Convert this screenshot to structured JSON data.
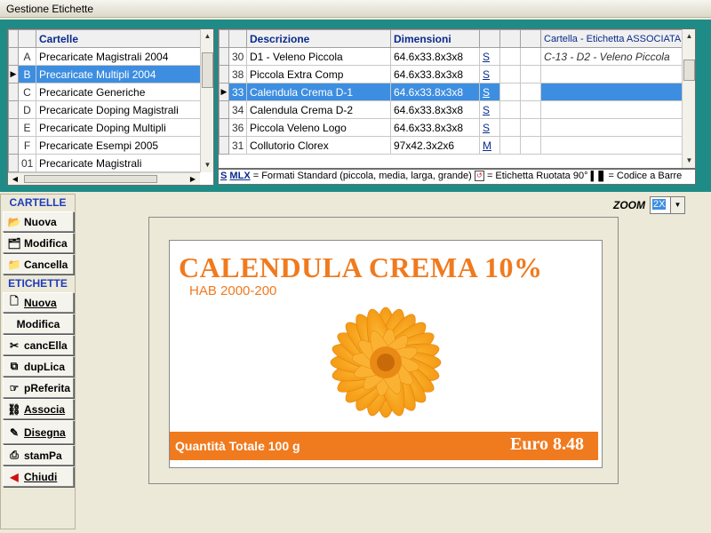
{
  "window": {
    "title": "Gestione Etichette"
  },
  "cartelle_grid": {
    "header": "Cartelle",
    "rows": [
      {
        "key": "A",
        "name": "Precaricate Magistrali 2004"
      },
      {
        "key": "B",
        "name": "Precaricate Multipli 2004"
      },
      {
        "key": "C",
        "name": "Precaricate Generiche"
      },
      {
        "key": "D",
        "name": "Precaricate Doping Magistrali"
      },
      {
        "key": "E",
        "name": "Precaricate Doping Multipli"
      },
      {
        "key": "F",
        "name": "Precaricate Esempi 2005"
      },
      {
        "key": "01",
        "name": "Precaricate Magistrali"
      }
    ]
  },
  "etichette_grid": {
    "headers": {
      "descrizione": "Descrizione",
      "dimensioni": "Dimensioni",
      "associata": "Cartella - Etichetta ASSOCIATA"
    },
    "rows": [
      {
        "num": "30",
        "desc": "D1 - Veleno Piccola",
        "dim": "64.6x33.8x3x8",
        "size": "S",
        "assoc": "C-13 - D2 - Veleno Piccola"
      },
      {
        "num": "38",
        "desc": "Piccola Extra Comp",
        "dim": "64.6x33.8x3x8",
        "size": "S",
        "assoc": ""
      },
      {
        "num": "33",
        "desc": "Calendula Crema D-1",
        "dim": "64.6x33.8x3x8",
        "size": "S",
        "assoc": ""
      },
      {
        "num": "34",
        "desc": "Calendula Crema D-2",
        "dim": "64.6x33.8x3x8",
        "size": "S",
        "assoc": ""
      },
      {
        "num": "36",
        "desc": "Piccola Veleno Logo",
        "dim": "64.6x33.8x3x8",
        "size": "S",
        "assoc": ""
      },
      {
        "num": "31",
        "desc": "Collutorio Clorex",
        "dim": "97x42.3x2x6",
        "size": "M",
        "assoc": ""
      }
    ]
  },
  "legend": {
    "sizes": [
      "S",
      "M",
      "L",
      "X"
    ],
    "formats_text": "= Formati Standard (piccola, media, larga, grande)",
    "rotated_text": "= Etichetta Ruotata 90°",
    "barcode_text": "= Codice a Barre"
  },
  "sidebar": {
    "cartelle_label": "CARTELLE",
    "etichette_label": "ETICHETTE",
    "buttons": {
      "nuova_c": "Nuova",
      "modifica_c": "Modifica",
      "cancella_c": "Cancella",
      "nuova_e": "Nuova",
      "modifica_e": "Modifica",
      "cancella_e": "cancEll­a",
      "duplica": "dupLica",
      "preferita": "pReferita",
      "associa": "Associa",
      "disegna": "Disegna",
      "stampa": "stamPa",
      "chiudi": "Chiudi"
    }
  },
  "zoom": {
    "label": "ZOOM",
    "value": "2X"
  },
  "label_preview": {
    "title": "CALENDULA CREMA 10%",
    "code": "HAB  2000-200",
    "quantity": "Quantità Totale 100 g",
    "price": "Euro 8.48"
  }
}
